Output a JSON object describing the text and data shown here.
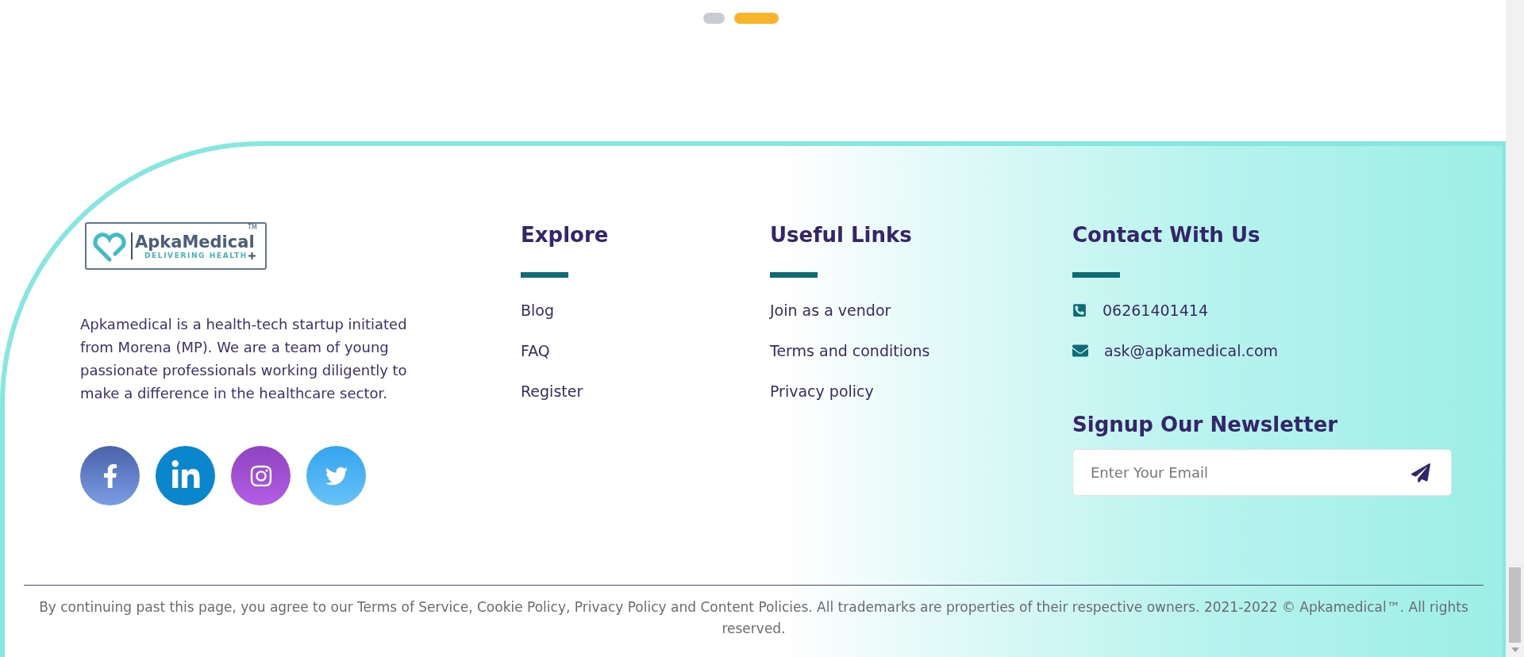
{
  "carousel_dots": [
    {
      "selected": false
    },
    {
      "selected": true
    }
  ],
  "logo": {
    "name": "ApkaMedical",
    "trademark": "TM",
    "tagline": "DELIVERING HEALTH"
  },
  "about": "Apkamedical is a health-tech startup initiated from Morena (MP). We are a team of young passionate professionals working diligently to make a difference in the healthcare sector.",
  "columns": [
    {
      "title": "Explore",
      "links": [
        "Blog",
        "FAQ",
        "Register"
      ]
    },
    {
      "title": "Useful Links",
      "links": [
        "Join as a vendor",
        "Terms and conditions",
        "Privacy policy"
      ]
    }
  ],
  "contact": {
    "title": "Contact With Us",
    "items": [
      {
        "kind": "phone",
        "text": "06261401414"
      },
      {
        "kind": "email",
        "text": "ask@apkamedical.com"
      }
    ]
  },
  "newsletter": {
    "title": "Signup Our Newsletter",
    "placeholder": "Enter Your Email"
  },
  "legal": "By continuing past this page, you agree to our Terms of Service, Cookie Policy, Privacy Policy and Content Policies. All trademarks are properties of their respective owners. 2021-2022 © Apkamedical™. All rights reserved."
}
